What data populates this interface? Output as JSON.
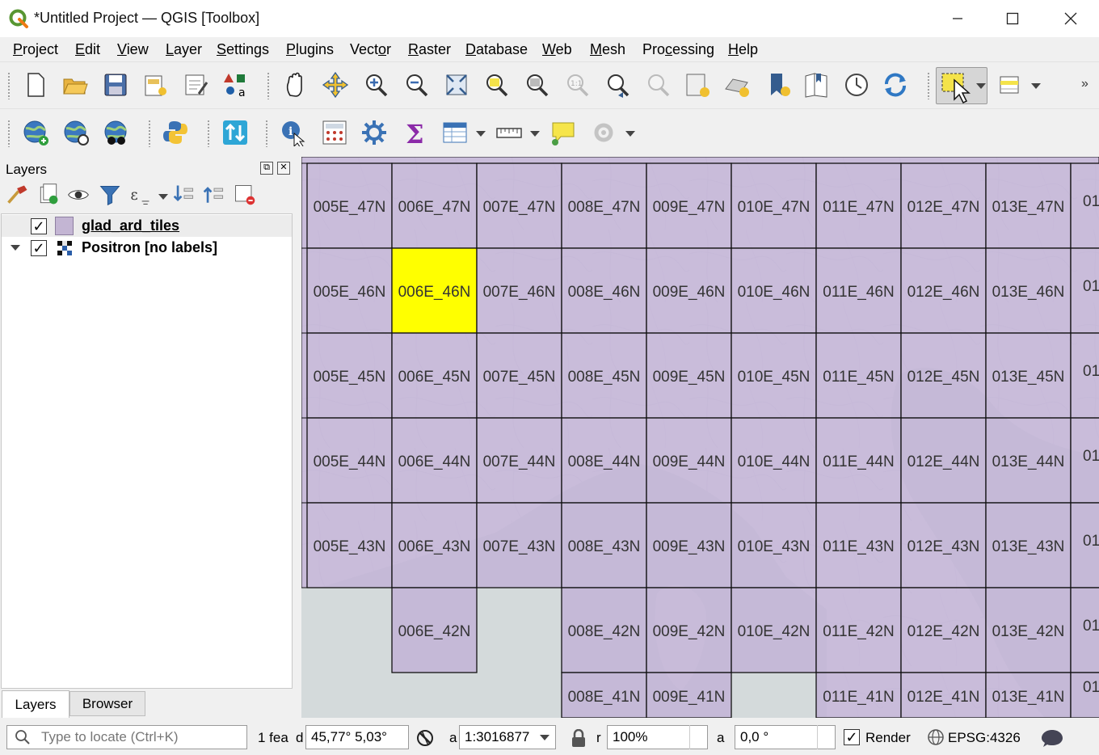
{
  "window": {
    "title": "*Untitled Project — QGIS [Toolbox]",
    "minimize": "—",
    "maximize": "☐",
    "close": "✕"
  },
  "menu": [
    {
      "label": "Project",
      "key": "P",
      "rest": "roject"
    },
    {
      "label": "Edit",
      "key": "E",
      "rest": "dit"
    },
    {
      "label": "View",
      "key": "V",
      "rest": "iew"
    },
    {
      "label": "Layer",
      "key": "L",
      "rest": "ayer"
    },
    {
      "label": "Settings",
      "key": "S",
      "rest": "ettings"
    },
    {
      "label": "Plugins",
      "key": "P",
      "rest": "lugins"
    },
    {
      "label": "Vector",
      "key": "o",
      "pre": "Vect",
      "rest": "r"
    },
    {
      "label": "Raster",
      "key": "R",
      "rest": "aster"
    },
    {
      "label": "Database",
      "key": "D",
      "rest": "atabase"
    },
    {
      "label": "Web",
      "key": "W",
      "rest": "eb"
    },
    {
      "label": "Mesh",
      "key": "M",
      "rest": "esh"
    },
    {
      "label": "Processing",
      "key": "c",
      "pre": "Pro",
      "rest": "essing"
    },
    {
      "label": "Help",
      "key": "H",
      "rest": "elp"
    }
  ],
  "layers_panel": {
    "title": "Layers",
    "layers": [
      {
        "name": "glad_ard_tiles",
        "checked": true,
        "symbol_color": "#c3b5d3"
      },
      {
        "name": "Positron [no labels]",
        "checked": true
      }
    ],
    "tabs": [
      "Layers",
      "Browser"
    ]
  },
  "map": {
    "tile_color": "#c2b3d6",
    "selected_color": "#ffff00",
    "rows": [
      {
        "lat": "47N",
        "lons": [
          "005E",
          "006E",
          "007E",
          "008E",
          "009E",
          "010E",
          "011E",
          "012E",
          "013E"
        ],
        "partial": "01"
      },
      {
        "lat": "46N",
        "lons": [
          "005E",
          "006E",
          "007E",
          "008E",
          "009E",
          "010E",
          "011E",
          "012E",
          "013E"
        ],
        "partial": "01"
      },
      {
        "lat": "45N",
        "lons": [
          "005E",
          "006E",
          "007E",
          "008E",
          "009E",
          "010E",
          "011E",
          "012E",
          "013E"
        ],
        "partial": "01"
      },
      {
        "lat": "44N",
        "lons": [
          "005E",
          "006E",
          "007E",
          "008E",
          "009E",
          "010E",
          "011E",
          "012E",
          "013E"
        ],
        "partial": "01"
      },
      {
        "lat": "43N",
        "lons": [
          "005E",
          "006E",
          "007E",
          "008E",
          "009E",
          "010E",
          "011E",
          "012E",
          "013E"
        ],
        "partial": "01"
      },
      {
        "lat": "42N",
        "lons": [
          "006E",
          "008E",
          "009E",
          "010E",
          "011E",
          "012E",
          "013E"
        ],
        "partial": "01"
      },
      {
        "lat": "41N",
        "lons": [
          "008E",
          "009E",
          "011E",
          "012E",
          "013E"
        ],
        "partial": "01"
      }
    ],
    "selected_tile": "006E_46N"
  },
  "statusbar": {
    "locate_placeholder": "Type to locate (Ctrl+K)",
    "features_text": "1 fea",
    "coordinate_label": "d",
    "coordinate": "45,77° 5,03°",
    "scale_label": "a",
    "scale": "1:3016877",
    "magnifier_label": "r",
    "magnifier": "100%",
    "rotation_label": "a",
    "rotation": "0,0 °",
    "render_label": "Render",
    "render_checked": true,
    "crs": "EPSG:4326"
  }
}
